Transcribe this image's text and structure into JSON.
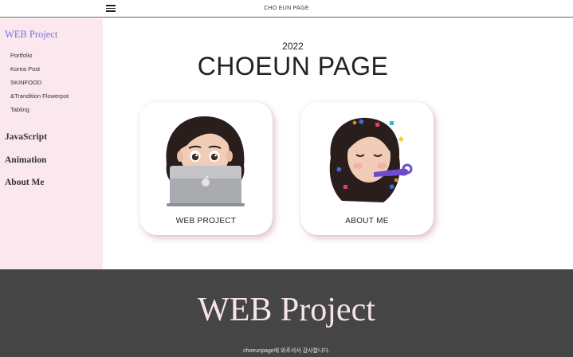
{
  "header": {
    "title": "CHO EUN PAGE",
    "menu_icon": "hamburger-menu-icon"
  },
  "sidebar": {
    "heading": "WEB Project",
    "sub_items": [
      {
        "label": "Portfolio"
      },
      {
        "label": "Korea Post"
      },
      {
        "label": "SKINFOOD"
      },
      {
        "label": "&Trandition Flowerpot"
      },
      {
        "label": "Tabling"
      }
    ],
    "main_items": [
      {
        "label": "JavaScript"
      },
      {
        "label": "Animation"
      },
      {
        "label": "About Me"
      }
    ]
  },
  "hero": {
    "year": "2022",
    "title": "CHOEUN PAGE"
  },
  "cards": [
    {
      "label": "WEB PROJECT",
      "icon": "memoji-laptop-icon"
    },
    {
      "label": "ABOUT ME",
      "icon": "memoji-party-icon"
    }
  ],
  "footer": {
    "title": "WEB Project",
    "note": "choeunpage에 와주셔서 감사합니다."
  },
  "colors": {
    "sidebar_bg": "#fbe7ee",
    "sidebar_heading": "#7474d6",
    "footer_bg": "#454545",
    "footer_title": "#f6e4ea"
  }
}
